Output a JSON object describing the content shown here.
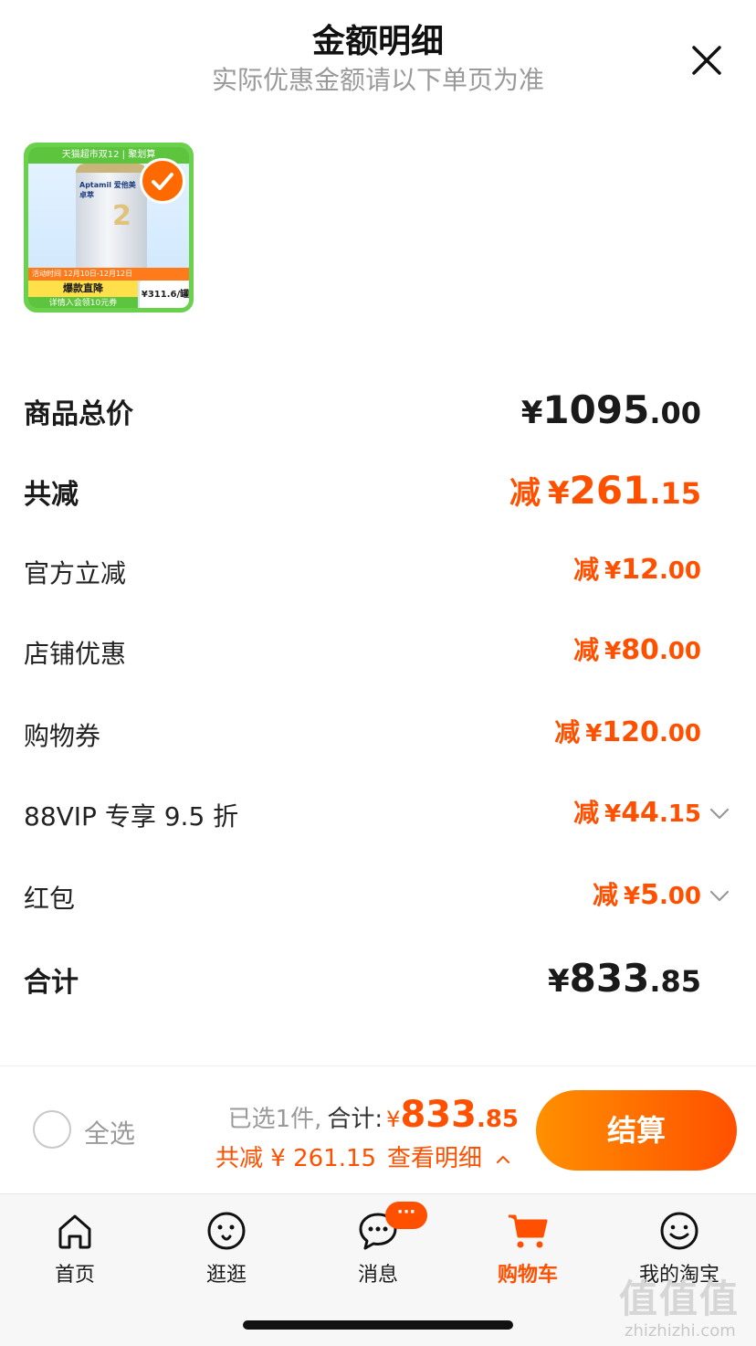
{
  "header": {
    "title": "金额明细",
    "subtitle": "实际优惠金额请以下单页为准"
  },
  "product": {
    "banner": "天猫超市双12 | 聚划算",
    "brand": "Aptamil 爱他美 卓萃",
    "stage": "2",
    "activity_date": "活动时间 12月10日-12月12日",
    "promo": "爆款直降",
    "coupon": "详情入会领10元券",
    "unit_price": "¥311.6/罐",
    "selected": true
  },
  "breakdown": {
    "total_price": {
      "label": "商品总价",
      "yen": "¥",
      "int": "1095",
      "dec": ".00"
    },
    "total_discount": {
      "label": "共减",
      "prefix": "减",
      "yen": "¥",
      "int": "261",
      "dec": ".15"
    },
    "items": [
      {
        "label": "官方立减",
        "prefix": "减",
        "yen": "¥",
        "int": "12",
        "dec": ".00",
        "expandable": false
      },
      {
        "label": "店铺优惠",
        "prefix": "减",
        "yen": "¥",
        "int": "80",
        "dec": ".00",
        "expandable": false
      },
      {
        "label": "购物券",
        "prefix": "减",
        "yen": "¥",
        "int": "120",
        "dec": ".00",
        "expandable": false
      },
      {
        "label": "88VIP 专享 9.5 折",
        "prefix": "减",
        "yen": "¥",
        "int": "44",
        "dec": ".15",
        "expandable": true
      },
      {
        "label": "红包",
        "prefix": "减",
        "yen": "¥",
        "int": "5",
        "dec": ".00",
        "expandable": true
      }
    ],
    "sum": {
      "label": "合计",
      "yen": "¥",
      "int": "833",
      "dec": ".85"
    }
  },
  "settle": {
    "select_all_label": "全选",
    "selected_count_text": "已选1件,",
    "total_label": "合计:",
    "yen": "¥",
    "int": "833",
    "dec": ".85",
    "saved_text": "共减 ¥ 261.15",
    "details_link": "查看明细",
    "checkout_label": "结算"
  },
  "tabbar": {
    "tabs": [
      {
        "label": "首页",
        "icon": "home-icon"
      },
      {
        "label": "逛逛",
        "icon": "browse-icon"
      },
      {
        "label": "消息",
        "icon": "message-icon",
        "badge": "···"
      },
      {
        "label": "购物车",
        "icon": "cart-icon",
        "active": true
      },
      {
        "label": "我的淘宝",
        "icon": "profile-icon"
      }
    ]
  },
  "watermark": {
    "logo": "值值值",
    "site": "zhizhizhi.com"
  },
  "colors": {
    "accent": "#ff5000",
    "accent_light": "#ff9000",
    "muted": "#9a9a9a"
  }
}
